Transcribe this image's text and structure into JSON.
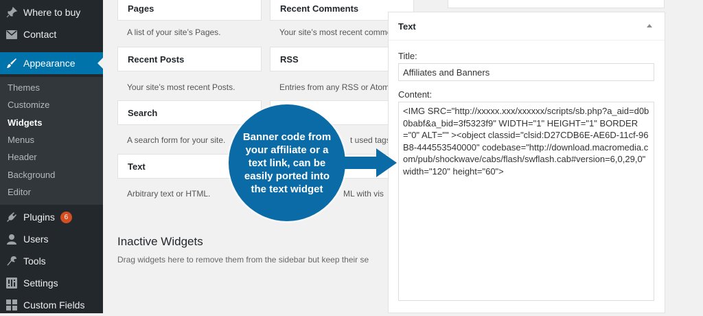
{
  "sidebar": {
    "menu": [
      {
        "label": "Where to buy",
        "icon": "pin-icon"
      },
      {
        "label": "Contact",
        "icon": "mail-icon"
      },
      {
        "label": "Appearance",
        "icon": "paintbrush-icon"
      },
      {
        "label": "Plugins",
        "icon": "plugin-icon",
        "badge": "6"
      },
      {
        "label": "Users",
        "icon": "users-icon"
      },
      {
        "label": "Tools",
        "icon": "wrench-icon"
      },
      {
        "label": "Settings",
        "icon": "settings-icon"
      },
      {
        "label": "Custom Fields",
        "icon": "grid-icon"
      }
    ],
    "submenu": [
      "Themes",
      "Customize",
      "Widgets",
      "Menus",
      "Header",
      "Background",
      "Editor"
    ]
  },
  "widgets": [
    {
      "title": "Pages",
      "desc": "A list of your site’s Pages."
    },
    {
      "title": "Recent Comments",
      "desc": "Your site’s most recent comme"
    },
    {
      "title": "Recent Posts",
      "desc": "Your site’s most recent Posts."
    },
    {
      "title": "RSS",
      "desc": "Entries from any RSS or Atom"
    },
    {
      "title": "Search",
      "desc": "A search form for your site."
    },
    {
      "title": "",
      "desc": "t used tags"
    },
    {
      "title": "Text",
      "desc": "Arbitrary text or HTML."
    },
    {
      "title": "",
      "desc": "ML with vis"
    }
  ],
  "inactive": {
    "title": "Inactive Widgets",
    "desc": "Drag widgets here to remove them from the sidebar but keep their se"
  },
  "text_widget": {
    "header": "Text",
    "title_label": "Title:",
    "title_value": "Affiliates and Banners",
    "content_label": "Content:",
    "content_value": "<IMG SRC=\"http://xxxxx.xxx/xxxxxx/scripts/sb.php?a_aid=d0b0babf&a_bid=3f5323f9\" WIDTH=\"1\" HEIGHT=\"1\" BORDER=\"0\" ALT=\"\" ><object classid=\"clsid:D27CDB6E-AE6D-11cf-96B8-444553540000\" codebase=\"http://download.macromedia.com/pub/shockwave/cabs/flash/swflash.cab#version=6,0,29,0\" width=\"120\" height=\"60\">"
  },
  "callout": {
    "text": "Banner code from your affiliate or a text link, can be easily ported into the  text widget"
  },
  "colors": {
    "sidebar_bg": "#23282d",
    "active": "#0073aa",
    "callout": "#0b6ba6",
    "badge": "#d54e21"
  }
}
